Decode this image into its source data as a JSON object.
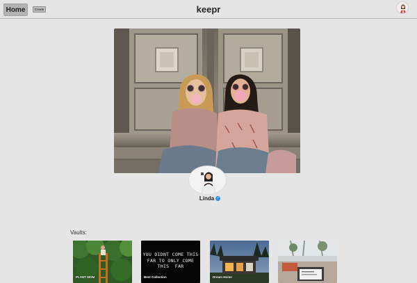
{
  "header": {
    "home_label": "Home",
    "create_label": "Create",
    "brand": "keepr",
    "avatar_icon": "user-avatar"
  },
  "profile": {
    "name": "Linda",
    "verified_icon": "verified-check-icon",
    "verified_color": "#2f8fe6"
  },
  "vaults": {
    "heading": "Vaults:",
    "items": [
      {
        "label": "PLANT MOM"
      },
      {
        "label": "Best Collection",
        "art_text": "YOU DIDNT COME THIS\nFAR TO ONLY COME\nTHIS  FAR"
      },
      {
        "label": "Dream Home"
      },
      {
        "label": ""
      }
    ]
  }
}
